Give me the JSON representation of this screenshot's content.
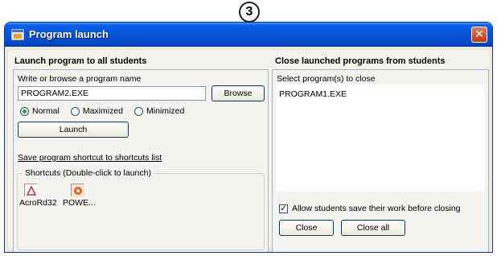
{
  "step_badge": "3",
  "window": {
    "title": "Program launch",
    "close_glyph": "✕"
  },
  "launch": {
    "section_title": "Launch program to all students",
    "field_label": "Write or browse  a program name",
    "program_value": "PROGRAM2.EXE",
    "browse_label": "Browse",
    "radio_options": [
      {
        "label": "Normal",
        "selected": true
      },
      {
        "label": "Maximized",
        "selected": false
      },
      {
        "label": "Minimized",
        "selected": false
      }
    ],
    "launch_label": "Launch",
    "save_shortcut_link": "Save program shortcut to shortcuts list",
    "shortcuts_legend": "Shortcuts (Double-click to launch)",
    "shortcuts": [
      {
        "label": "AcroRd32",
        "icon": "pdf-icon",
        "color": "#d32f2f"
      },
      {
        "label": "POWE...",
        "icon": "powerpoint-icon",
        "color": "#e0641a"
      }
    ]
  },
  "close": {
    "section_title": "Close launched programs from students",
    "list_label": "Select program(s) to close",
    "programs": [
      "PROGRAM1.EXE"
    ],
    "allow_save_label": "Allow students save their work before closing",
    "allow_save_checked": true,
    "close_label": "Close",
    "close_all_label": "Close all"
  },
  "colors": {
    "titlebar": "#0454d8",
    "close_button": "#c2350f",
    "panel_border": "#9eb6d6"
  }
}
